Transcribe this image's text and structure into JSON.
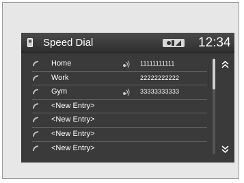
{
  "header": {
    "title": "Speed Dial",
    "clock": "12:34",
    "signal_icon": "phone-signal-icon"
  },
  "entries": [
    {
      "name": "Home",
      "number": "11111111111",
      "voice_tag": true
    },
    {
      "name": "Work",
      "number": "22222222222",
      "voice_tag": false
    },
    {
      "name": "Gym",
      "number": "33333333333",
      "voice_tag": true
    },
    {
      "name": "<New Entry>",
      "number": "",
      "voice_tag": false
    },
    {
      "name": "<New Entry>",
      "number": "",
      "voice_tag": false
    },
    {
      "name": "<New Entry>",
      "number": "",
      "voice_tag": false
    },
    {
      "name": "<New Entry>",
      "number": "",
      "voice_tag": false
    }
  ],
  "colors": {
    "screen_bg": "#3a3a3a",
    "text": "#ffffff",
    "frame_bg": "#e7e7e7"
  }
}
